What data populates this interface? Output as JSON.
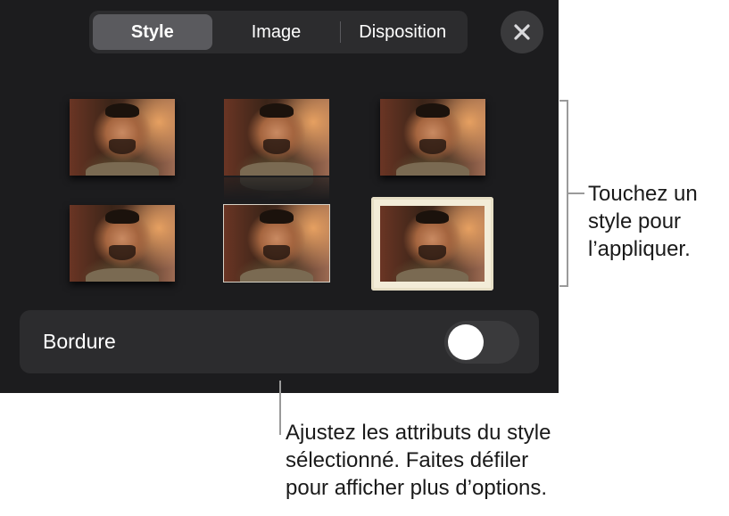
{
  "tabs": [
    {
      "label": "Style",
      "active": true
    },
    {
      "label": "Image",
      "active": false
    },
    {
      "label": "Disposition",
      "active": false
    }
  ],
  "close_icon": "close-icon",
  "style_thumbnails": [
    {
      "style": "drop shadow"
    },
    {
      "style": "reflection"
    },
    {
      "style": "contact shadow"
    },
    {
      "style": "shadow"
    },
    {
      "style": "thin border"
    },
    {
      "style": "picture frame"
    }
  ],
  "border_toggle": {
    "label": "Bordure",
    "on": false
  },
  "callouts": {
    "styles": "Touchez un\nstyle pour\nl’appliquer.",
    "attributes": "Ajustez les attributs du style\nsélectionné. Faites défiler\npour afficher plus d’options."
  },
  "colors": {
    "panel_bg": "#1c1c1e",
    "segment_bg": "#2c2c2e",
    "segment_active": "#5a5a5e",
    "toggle_off": "#3a3a3c",
    "callout_line": "#9a9a9a"
  }
}
